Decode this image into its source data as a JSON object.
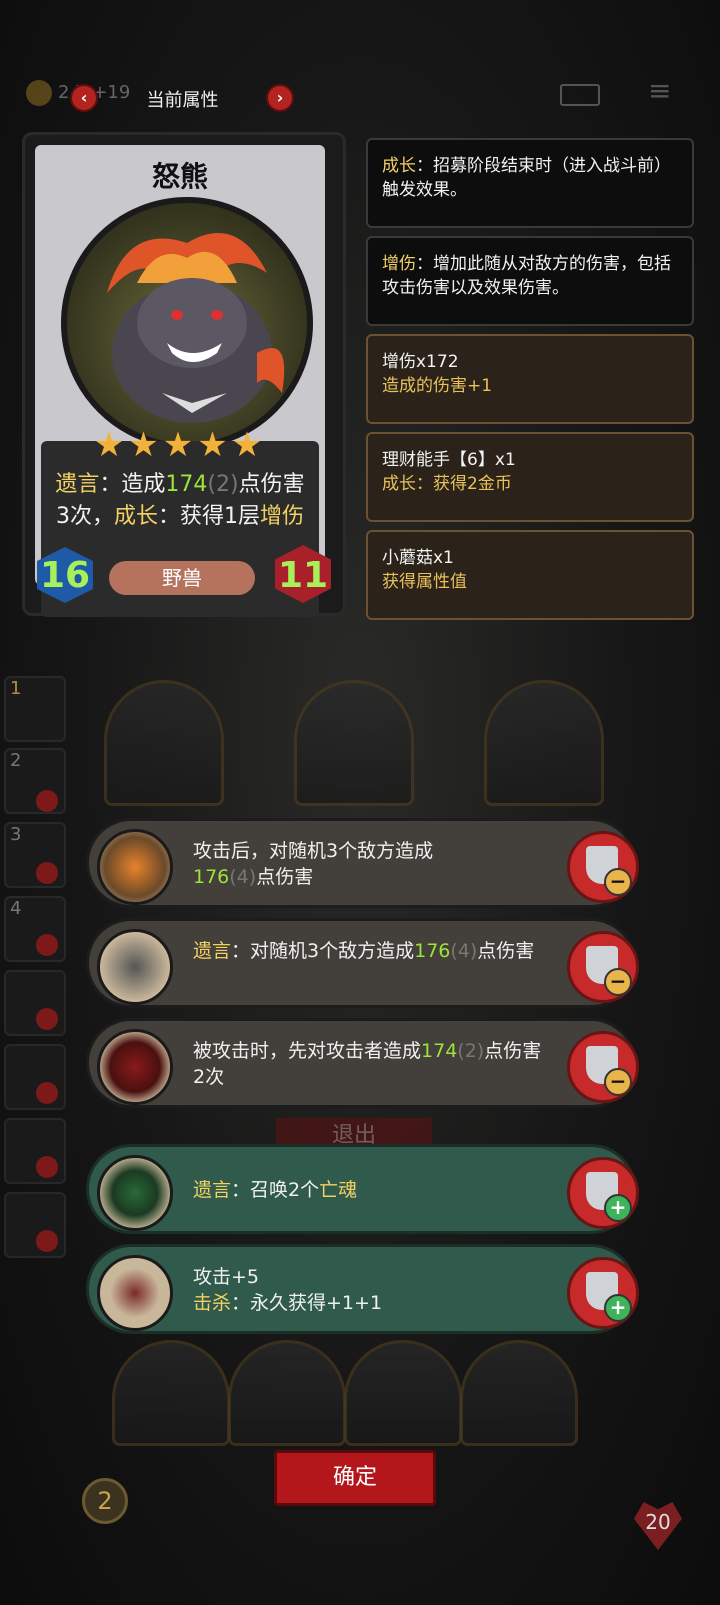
{
  "header": {
    "title": "当前属性",
    "prev_label": "‹",
    "next_label": "›",
    "coin_value": "2 7 +19"
  },
  "card": {
    "name": "怒熊",
    "stars": "★★★★★",
    "star_count": 5,
    "desc": {
      "p1": "遗言",
      "p2": "：造成",
      "p3": "174",
      "p4": "(2)",
      "p5": "点伤害3次，",
      "p6": "成长",
      "p7": "：获得1层",
      "p8": "增伤"
    },
    "attack": "16",
    "health": "11",
    "tribe": "野兽"
  },
  "info_panels": [
    {
      "k1": "成长",
      "t1": "：招募阶段结束时（进入战斗前）触发效果。"
    },
    {
      "k1": "增伤",
      "t1": "：增加此随从对敌方的伤害，包括攻击伤害以及效果伤害。"
    },
    {
      "l1": "增伤x172",
      "l2": "造成的伤害+1"
    },
    {
      "l1": "理财能手【6】x1",
      "l2": "成长：获得2金币"
    },
    {
      "l1": "小蘑菇x1",
      "l2": "获得属性值"
    }
  ],
  "abilities": [
    {
      "a": "攻击后，对随机3个敌方造成",
      "b": "176",
      "c": "(4)",
      "d": "点伤害",
      "icon": "explosion-icon",
      "action": "−"
    },
    {
      "a": "遗言",
      "b": "：对随机3个敌方造成",
      "c": "176",
      "d": "(4)",
      "e": "点伤害",
      "icon": "bomb-icon",
      "action": "−"
    },
    {
      "a": "被攻击时，先对攻击者造成",
      "b": "174",
      "c": "(2)",
      "d": "点伤害2次",
      "icon": "hooded-figure-icon",
      "action": "−"
    },
    {
      "a": "遗言",
      "b": "：召唤2个",
      "c": "亡魂",
      "icon": "lantern-icon",
      "action": "+"
    },
    {
      "a": "攻击+5",
      "b": "击杀",
      "c": "：永久获得+1+1",
      "icon": "spear-icon",
      "action": "+"
    }
  ],
  "footer": {
    "confirm_label": "确定",
    "exit_label": "退出",
    "life": "20",
    "gold": "2"
  },
  "sidebar_numbers": [
    "1",
    "2",
    "3",
    "4"
  ],
  "colors": {
    "accent_red": "#b3171c",
    "keyword_yellow": "#f3d162",
    "number_green": "#9ee33b"
  }
}
